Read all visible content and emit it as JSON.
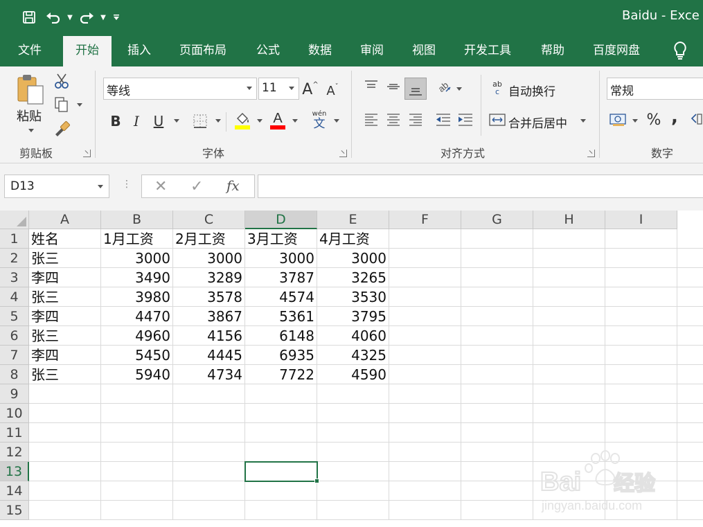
{
  "window": {
    "title": "Baidu - Exce"
  },
  "ribbon_tabs": [
    "文件",
    "开始",
    "插入",
    "页面布局",
    "公式",
    "数据",
    "审阅",
    "视图",
    "开发工具",
    "帮助",
    "百度网盘"
  ],
  "active_tab": "开始",
  "clipboard": {
    "paste_label": "粘贴",
    "group_label": "剪贴板"
  },
  "font": {
    "name": "等线",
    "size": "11",
    "group_label": "字体",
    "highlight_color": "#ffff00",
    "font_color": "#ff0000",
    "grow_glyph": "A",
    "shrink_glyph": "A",
    "bold": "B",
    "italic": "I",
    "underline": "U",
    "phonetic_top": "wén",
    "phonetic_bottom": "文"
  },
  "alignment": {
    "wrap_text": "自动换行",
    "merge_center": "合并后居中",
    "group_label": "对齐方式",
    "wrap_glyph_top": "ab",
    "wrap_glyph_bottom": "c"
  },
  "number": {
    "format": "常规",
    "group_label": "数字",
    "percent": "%",
    "comma": ","
  },
  "formula_bar": {
    "name_box": "D13",
    "fx": "fx",
    "value": ""
  },
  "columns": [
    "A",
    "B",
    "C",
    "D",
    "E",
    "F",
    "G",
    "H",
    "I"
  ],
  "selected_column": "D",
  "rows": [
    "1",
    "2",
    "3",
    "4",
    "5",
    "6",
    "7",
    "8",
    "9",
    "10",
    "11",
    "12",
    "13",
    "14",
    "15"
  ],
  "selected_row": "13",
  "active_cell": "D13",
  "header_row": [
    "姓名",
    "1月工资",
    "2月工资",
    "3月工资",
    "4月工资"
  ],
  "data_rows": [
    [
      "张三",
      "3000",
      "3000",
      "3000",
      "3000"
    ],
    [
      "李四",
      "3490",
      "3289",
      "3787",
      "3265"
    ],
    [
      "张三",
      "3980",
      "3578",
      "4574",
      "3530"
    ],
    [
      "李四",
      "4470",
      "3867",
      "5361",
      "3795"
    ],
    [
      "张三",
      "4960",
      "4156",
      "6148",
      "4060"
    ],
    [
      "李四",
      "5450",
      "4445",
      "6935",
      "4325"
    ],
    [
      "张三",
      "5940",
      "4734",
      "7722",
      "4590"
    ]
  ],
  "watermark": {
    "text": "Baidu经验",
    "url": "jingyan.baidu.com"
  },
  "colors": {
    "brand": "#217346",
    "ribbon_bg": "#f3f3f3",
    "header_bg": "#e6e6e6"
  }
}
